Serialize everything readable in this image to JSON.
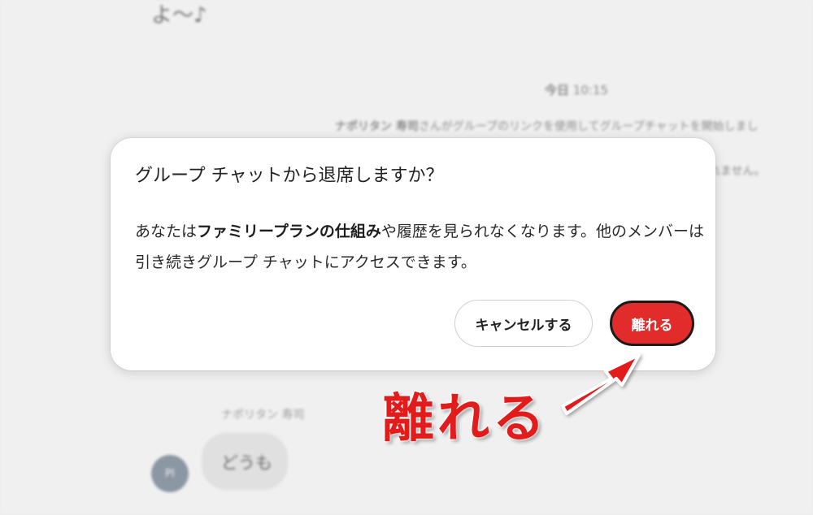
{
  "background": {
    "top_message": "よ〜♪",
    "date_label": "今日",
    "date_time": "10:15",
    "system_line1_name": "ナポリタン 寿司",
    "system_line1_rest": "さんがグループのリンクを使用してグループチャットを開始しまし",
    "system_line2": "れません。",
    "sender_name": "ナポリタン 寿司",
    "message_text": "どうも",
    "avatar_initials": "PI"
  },
  "dialog": {
    "title": "グループ チャットから退席しますか？",
    "body_part1": "あなたは",
    "body_bold": "ファミリープランの仕組み",
    "body_part2": "や履歴を見られなくなります。他のメンバーは引き続きグループ チャットにアクセスできます。",
    "cancel_label": "キャンセルする",
    "leave_label": "離れる"
  },
  "annotation": {
    "label": "離れる",
    "color": "#e21b1b"
  },
  "colors": {
    "leave_button": "#e22b2b",
    "avatar": "#8c97a4"
  }
}
